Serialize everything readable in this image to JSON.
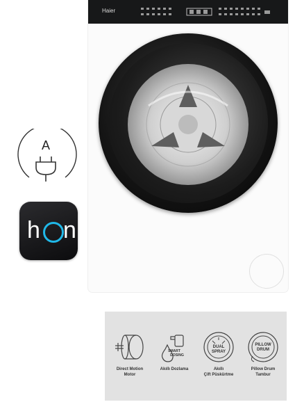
{
  "energy_badge": {
    "letter": "A",
    "icon": "plug-icon"
  },
  "app_tile": {
    "h": "h",
    "n": "n",
    "icon": "hon-app-icon",
    "accent": "#20b8e8"
  },
  "washer": {
    "brand": "Haier",
    "panel_color": "#171819"
  },
  "features": [
    {
      "icon": "motor-icon",
      "line1": "Direct Motion",
      "line2": "Motor"
    },
    {
      "icon": "smart-dosing-icon",
      "badge": "SMART DOSING",
      "line1": "Akıllı Dozlama",
      "line2": ""
    },
    {
      "icon": "dual-spray-icon",
      "badge": "DUAL SPRAY",
      "line1": "Akıllı",
      "line2": "Çift Püskürtme"
    },
    {
      "icon": "pillow-drum-icon",
      "badge": "PILLOW DRUM",
      "line1": "Pillow Drum",
      "line2": "Tambur"
    }
  ]
}
